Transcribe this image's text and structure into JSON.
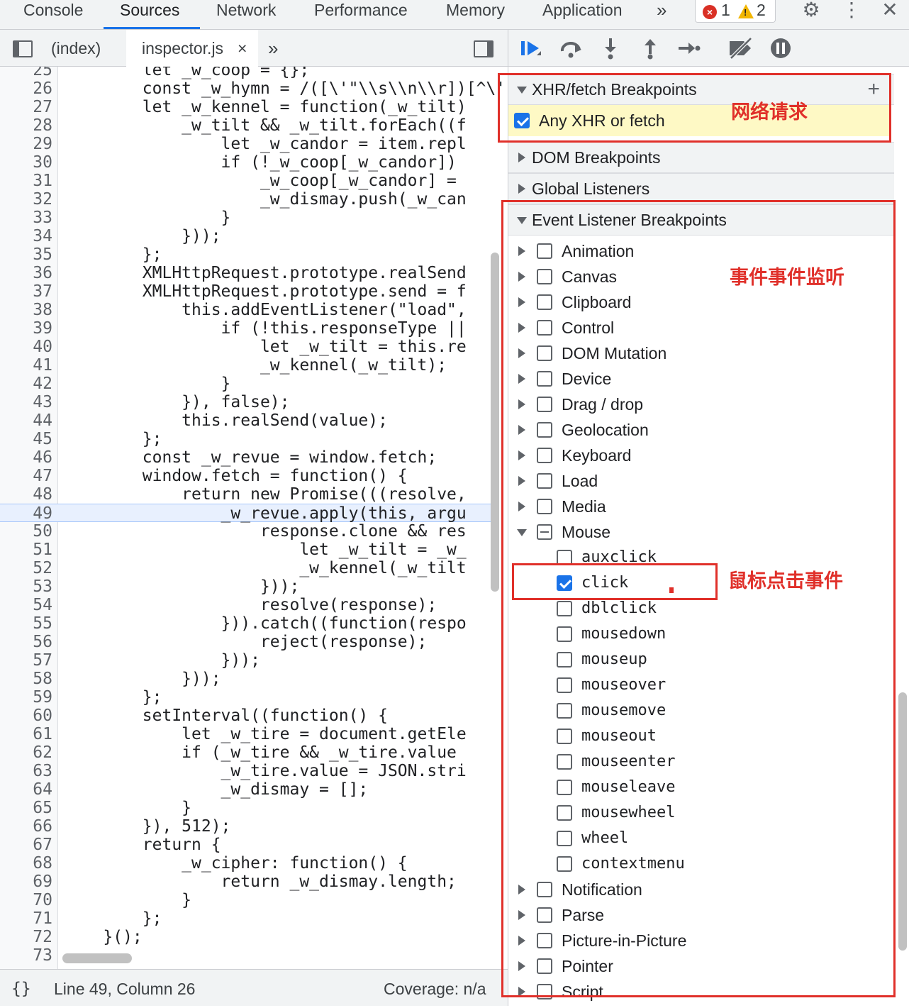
{
  "tabs": [
    {
      "label": "Console",
      "active": false
    },
    {
      "label": "Sources",
      "active": true
    },
    {
      "label": "Network",
      "active": false
    },
    {
      "label": "Performance",
      "active": false
    },
    {
      "label": "Memory",
      "active": false
    },
    {
      "label": "Application",
      "active": false
    }
  ],
  "more_tabs": "»",
  "issues": {
    "errors": "1",
    "warnings": "2"
  },
  "editor_tabs": {
    "index": "(index)",
    "active": "inspector.js",
    "close": "×",
    "more": "»"
  },
  "code_lines": [
    {
      "n": "25",
      "code": "        let _w_coop = {};"
    },
    {
      "n": "26",
      "code": "        const _w_hymn = /([\\'\"\\\\s\\\\n\\\\r])[^\\'\""
    },
    {
      "n": "27",
      "code": "        let _w_kennel = function(_w_tilt)"
    },
    {
      "n": "28",
      "code": "            _w_tilt && _w_tilt.forEach((f"
    },
    {
      "n": "29",
      "code": "                let _w_candor = item.repl"
    },
    {
      "n": "30",
      "code": "                if (!_w_coop[_w_candor])"
    },
    {
      "n": "31",
      "code": "                    _w_coop[_w_candor] ="
    },
    {
      "n": "32",
      "code": "                    _w_dismay.push(_w_can"
    },
    {
      "n": "33",
      "code": "                }"
    },
    {
      "n": "34",
      "code": "            }));"
    },
    {
      "n": "35",
      "code": "        };"
    },
    {
      "n": "36",
      "code": "        XMLHttpRequest.prototype.realSend"
    },
    {
      "n": "37",
      "code": "        XMLHttpRequest.prototype.send = f"
    },
    {
      "n": "38",
      "code": "            this.addEventListener(\"load\","
    },
    {
      "n": "39",
      "code": "                if (!this.responseType ||"
    },
    {
      "n": "40",
      "code": "                    let _w_tilt = this.re"
    },
    {
      "n": "41",
      "code": "                    _w_kennel(_w_tilt);"
    },
    {
      "n": "42",
      "code": "                }"
    },
    {
      "n": "43",
      "code": "            }), false);"
    },
    {
      "n": "44",
      "code": "            this.realSend(value);"
    },
    {
      "n": "45",
      "code": "        };"
    },
    {
      "n": "46",
      "code": "        const _w_revue = window.fetch;"
    },
    {
      "n": "47",
      "code": "        window.fetch = function() {"
    },
    {
      "n": "48",
      "code": "            return new Promise(((resolve,"
    },
    {
      "n": "49",
      "code": "                _w_revue.apply(this, argu"
    },
    {
      "n": "50",
      "code": "                    response.clone && res"
    },
    {
      "n": "51",
      "code": "                        let _w_tilt = _w_"
    },
    {
      "n": "52",
      "code": "                        _w_kennel(_w_tilt"
    },
    {
      "n": "53",
      "code": "                    }));"
    },
    {
      "n": "54",
      "code": "                    resolve(response);"
    },
    {
      "n": "55",
      "code": "                })).catch((function(respo"
    },
    {
      "n": "56",
      "code": "                    reject(response);"
    },
    {
      "n": "57",
      "code": "                }));"
    },
    {
      "n": "58",
      "code": "            }));"
    },
    {
      "n": "59",
      "code": "        };"
    },
    {
      "n": "60",
      "code": "        setInterval((function() {"
    },
    {
      "n": "61",
      "code": "            let _w_tire = document.getEle"
    },
    {
      "n": "62",
      "code": "            if (_w_tire && _w_tire.value"
    },
    {
      "n": "63",
      "code": "                _w_tire.value = JSON.stri"
    },
    {
      "n": "64",
      "code": "                _w_dismay = [];"
    },
    {
      "n": "65",
      "code": "            }"
    },
    {
      "n": "66",
      "code": "        }), 512);"
    },
    {
      "n": "67",
      "code": "        return {"
    },
    {
      "n": "68",
      "code": "            _w_cipher: function() {"
    },
    {
      "n": "69",
      "code": "                return _w_dismay.length;"
    },
    {
      "n": "70",
      "code": "            }"
    },
    {
      "n": "71",
      "code": "        };"
    },
    {
      "n": "72",
      "code": "    }();"
    },
    {
      "n": "73",
      "code": ""
    }
  ],
  "highlight_line": "49",
  "status": {
    "braces": "{}",
    "position": "Line 49, Column 26",
    "coverage": "Coverage: n/a"
  },
  "breakpoints": {
    "xhr": {
      "title": "XHR/fetch Breakpoints",
      "plus": "+",
      "any_label": "Any XHR or fetch",
      "any_checked": true
    },
    "dom": {
      "title": "DOM Breakpoints"
    },
    "global": {
      "title": "Global Listeners"
    },
    "event": {
      "title": "Event Listener Breakpoints"
    }
  },
  "categories_top": [
    "Animation",
    "Canvas",
    "Clipboard",
    "Control",
    "DOM Mutation",
    "Device",
    "Drag / drop",
    "Geolocation",
    "Keyboard",
    "Load",
    "Media"
  ],
  "mouse": {
    "label": "Mouse",
    "state": "mixed"
  },
  "mouse_events": [
    {
      "label": "auxclick",
      "checked": false
    },
    {
      "label": "click",
      "checked": true
    },
    {
      "label": "dblclick",
      "checked": false
    },
    {
      "label": "mousedown",
      "checked": false
    },
    {
      "label": "mouseup",
      "checked": false
    },
    {
      "label": "mouseover",
      "checked": false
    },
    {
      "label": "mousemove",
      "checked": false
    },
    {
      "label": "mouseout",
      "checked": false
    },
    {
      "label": "mouseenter",
      "checked": false
    },
    {
      "label": "mouseleave",
      "checked": false
    },
    {
      "label": "mousewheel",
      "checked": false
    },
    {
      "label": "wheel",
      "checked": false
    },
    {
      "label": "contextmenu",
      "checked": false
    }
  ],
  "categories_bottom": [
    "Notification",
    "Parse",
    "Picture-in-Picture",
    "Pointer",
    "Script"
  ],
  "annotations": {
    "network": "网络请求",
    "events": "事件事件监听",
    "mouse_click": "鼠标点击事件"
  },
  "colors": {
    "accent": "#1a73e8",
    "annotation": "#e0302a",
    "highlight_row": "#fef9c5"
  }
}
